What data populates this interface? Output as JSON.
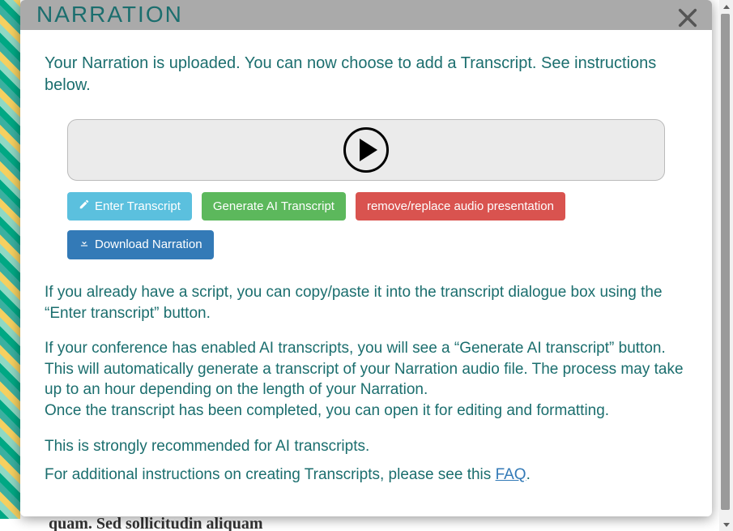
{
  "modal": {
    "title": "NARRATION",
    "lead": "Your Narration is uploaded. You can now choose to add a Transcript. See instructions below.",
    "buttons": {
      "enter": "Enter Transcript",
      "generate": "Generate AI Transcript",
      "remove": "remove/replace audio presentation",
      "download": "Download Narration"
    },
    "para1": "If you already have a script, you can copy/paste it into the transcript dialogue box using the “Enter transcript” button.",
    "para2a": "If your conference has enabled AI transcripts, you will see a “Generate AI transcript” button. This will automatically generate a transcript of your Narration audio file. The process may take up to an hour depending on the length of your Narration.",
    "para2b": "Once the transcript has been completed, you can open it for editing and formatting.",
    "para3": "This is strongly recommended for AI transcripts.",
    "para4_prefix": "For additional instructions on creating Transcripts, please see this ",
    "para4_link": "FAQ",
    "para4_suffix": "."
  },
  "background": {
    "cutoff_text": "quam. Sed sollicitudin aliquam"
  }
}
